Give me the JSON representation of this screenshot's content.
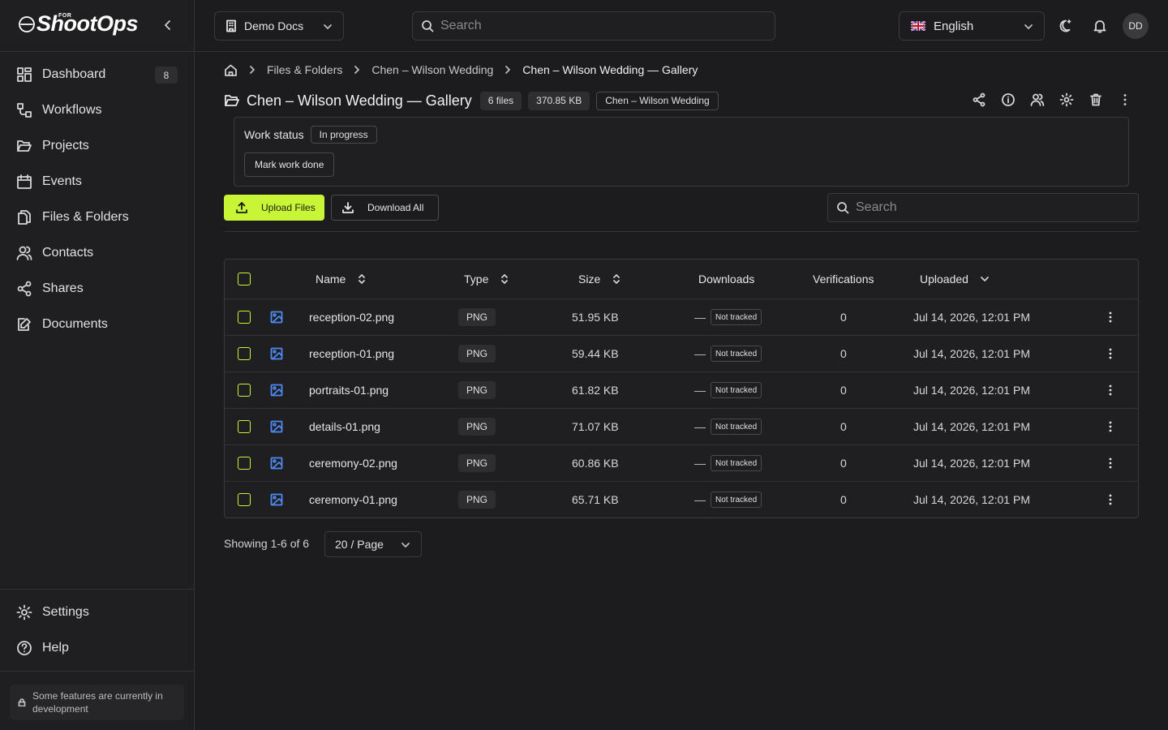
{
  "brand": {
    "name": "ShootOps",
    "tagline": "FOR"
  },
  "sidebar": {
    "items": [
      {
        "label": "Dashboard",
        "badge": "8"
      },
      {
        "label": "Workflows"
      },
      {
        "label": "Projects"
      },
      {
        "label": "Events"
      },
      {
        "label": "Files & Folders"
      },
      {
        "label": "Contacts"
      },
      {
        "label": "Shares"
      },
      {
        "label": "Documents"
      }
    ],
    "bottom": [
      {
        "label": "Settings"
      },
      {
        "label": "Help"
      }
    ],
    "dev_note": "Some features are currently in development"
  },
  "header": {
    "workspace": "Demo Docs",
    "search_placeholder": "Search",
    "language": "English",
    "avatar_initials": "DD"
  },
  "breadcrumb": [
    "Files & Folders",
    "Chen – Wilson Wedding",
    "Chen – Wilson Wedding — Gallery"
  ],
  "folder": {
    "title": "Chen – Wilson Wedding — Gallery",
    "file_count": "6 files",
    "total_size": "370.85 KB",
    "project": "Chen – Wilson Wedding"
  },
  "work_status": {
    "label": "Work status",
    "value": "In progress",
    "action": "Mark work done"
  },
  "toolbar": {
    "upload_label": "Upload Files",
    "download_label": "Download All",
    "search_placeholder": "Search"
  },
  "table": {
    "columns": {
      "name": "Name",
      "type": "Type",
      "size": "Size",
      "downloads": "Downloads",
      "verifications": "Verifications",
      "uploaded": "Uploaded"
    },
    "rows": [
      {
        "name": "reception-02.png",
        "type": "PNG",
        "size": "51.95 KB",
        "downloads": "—",
        "tracking": "Not tracked",
        "verifications": "0",
        "uploaded": "Jul 14, 2026, 12:01 PM"
      },
      {
        "name": "reception-01.png",
        "type": "PNG",
        "size": "59.44 KB",
        "downloads": "—",
        "tracking": "Not tracked",
        "verifications": "0",
        "uploaded": "Jul 14, 2026, 12:01 PM"
      },
      {
        "name": "portraits-01.png",
        "type": "PNG",
        "size": "61.82 KB",
        "downloads": "—",
        "tracking": "Not tracked",
        "verifications": "0",
        "uploaded": "Jul 14, 2026, 12:01 PM"
      },
      {
        "name": "details-01.png",
        "type": "PNG",
        "size": "71.07 KB",
        "downloads": "—",
        "tracking": "Not tracked",
        "verifications": "0",
        "uploaded": "Jul 14, 2026, 12:01 PM"
      },
      {
        "name": "ceremony-02.png",
        "type": "PNG",
        "size": "60.86 KB",
        "downloads": "—",
        "tracking": "Not tracked",
        "verifications": "0",
        "uploaded": "Jul 14, 2026, 12:01 PM"
      },
      {
        "name": "ceremony-01.png",
        "type": "PNG",
        "size": "65.71 KB",
        "downloads": "—",
        "tracking": "Not tracked",
        "verifications": "0",
        "uploaded": "Jul 14, 2026, 12:01 PM"
      }
    ]
  },
  "pagination": {
    "showing": "Showing 1-6 of 6",
    "page_size": "20 / Page"
  },
  "colors": {
    "accent": "#c8f536",
    "file_icon": "#4d8cf5",
    "background": "#1c1c1e"
  }
}
